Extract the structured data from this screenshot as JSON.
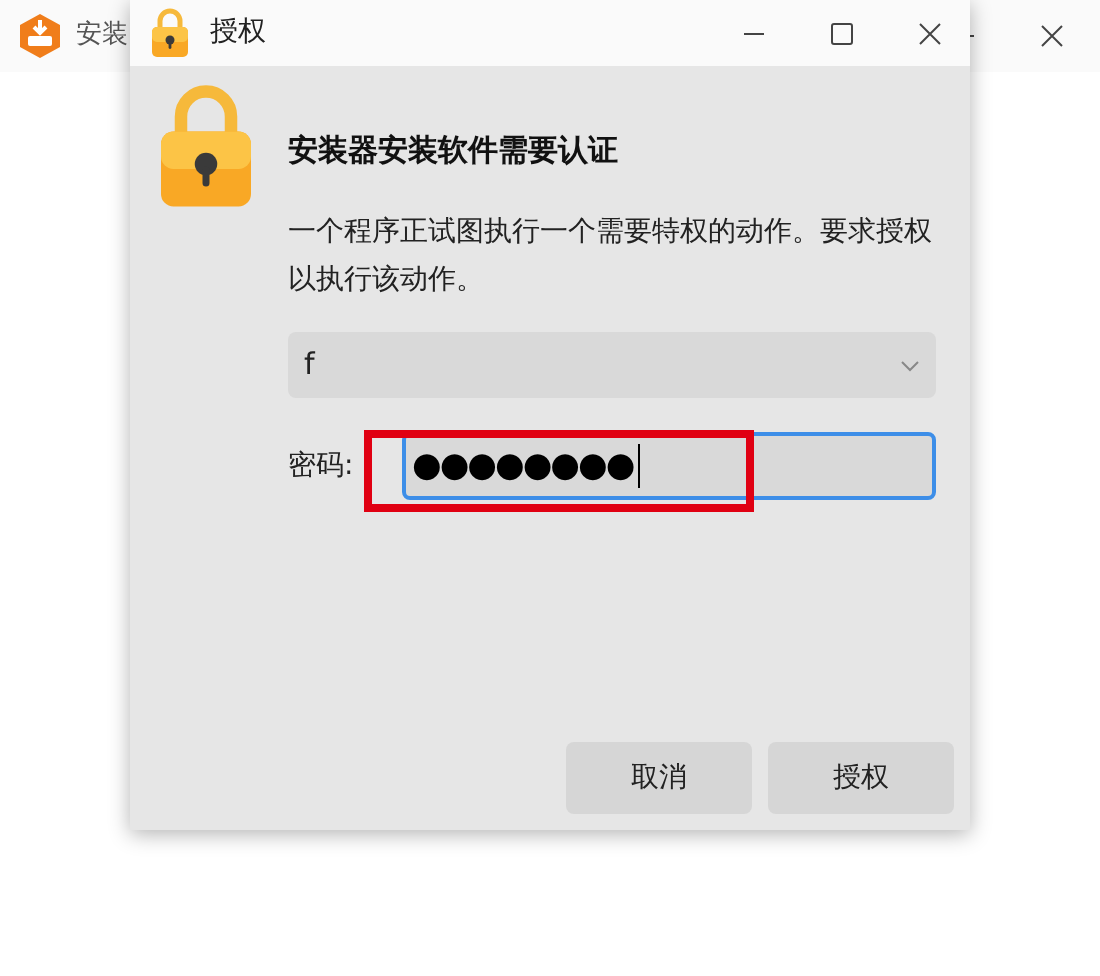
{
  "background_window": {
    "title": "安装"
  },
  "dialog": {
    "title": "授权",
    "heading": "安装器安装软件需要认证",
    "message": "一个程序正试图执行一个需要特权的动作。要求授权以执行该动作。",
    "user_select": {
      "value": "f"
    },
    "password": {
      "label": "密码:",
      "value": "●●●●●●●●",
      "focused": true,
      "highlighted": true
    },
    "buttons": [
      "取消",
      "授权"
    ]
  }
}
